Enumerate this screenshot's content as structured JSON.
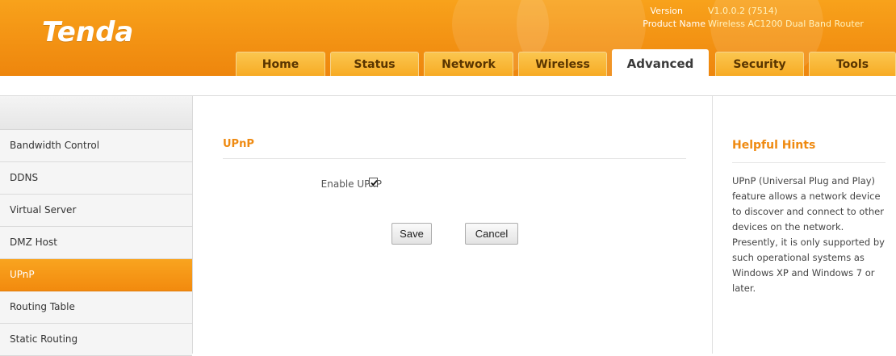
{
  "brand": {
    "logo_text": "Tenda",
    "primary_color": "#f39213",
    "accent_text_color": "#ef8a11"
  },
  "version_info": {
    "version_label": "Version",
    "version_value": "V1.0.0.2 (7514)",
    "product_label": "Product Name",
    "product_value": "Wireless AC1200 Dual Band Router"
  },
  "tabs": [
    {
      "label": "Home"
    },
    {
      "label": "Status"
    },
    {
      "label": "Network"
    },
    {
      "label": "Wireless"
    },
    {
      "label": "Advanced",
      "active": true
    },
    {
      "label": "Security"
    },
    {
      "label": "Tools"
    }
  ],
  "sidebar": {
    "items": [
      {
        "label": "Bandwidth Control"
      },
      {
        "label": "DDNS"
      },
      {
        "label": "Virtual Server"
      },
      {
        "label": "DMZ Host"
      },
      {
        "label": "UPnP",
        "active": true
      },
      {
        "label": "Routing Table"
      },
      {
        "label": "Static Routing"
      }
    ]
  },
  "main": {
    "section_title": "UPnP",
    "enable_upnp_label": "Enable UPnP",
    "enable_upnp_checked": true,
    "save_label": "Save",
    "cancel_label": "Cancel"
  },
  "hints": {
    "title": "Helpful Hints",
    "text": "UPnP (Universal Plug and Play) feature allows a network device to discover and connect to other devices on the network. Presently, it is only supported by such operational systems as Windows XP and Windows 7 or later."
  }
}
